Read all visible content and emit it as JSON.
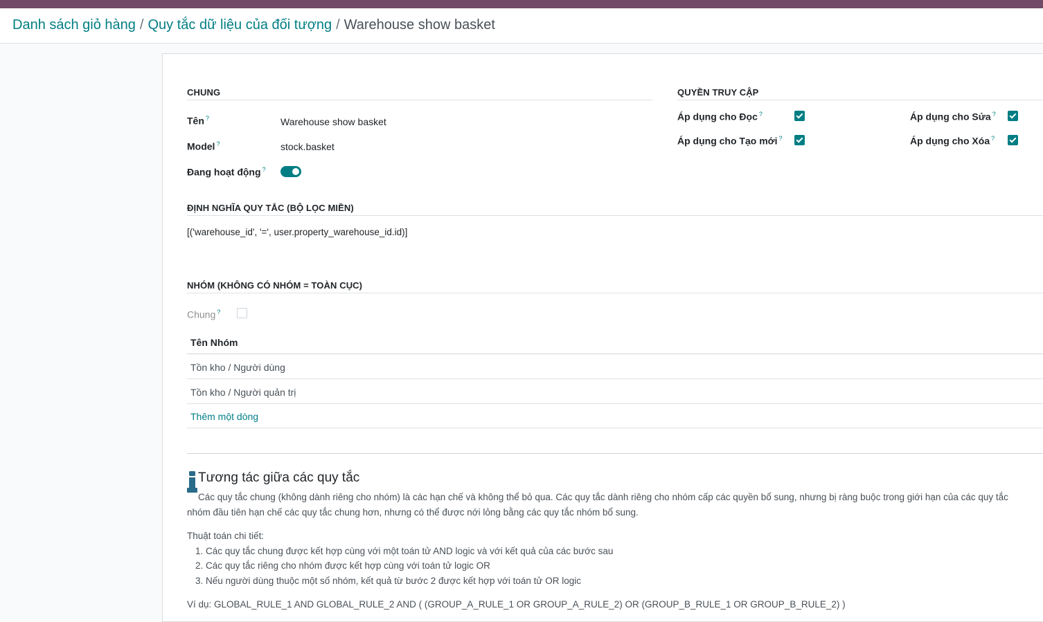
{
  "breadcrumb": {
    "items": [
      "Danh sách giỏ hàng",
      "Quy tắc dữ liệu của đối tượng"
    ],
    "current": "Warehouse show basket",
    "separator": "/"
  },
  "general": {
    "section_title": "CHUNG",
    "name_label": "Tên",
    "name_value": "Warehouse show basket",
    "model_label": "Model",
    "model_value": "stock.basket",
    "active_label": "Đang hoạt động",
    "active": true
  },
  "access": {
    "section_title": "QUYỀN TRUY CẬP",
    "read_label": "Áp dụng cho Đọc",
    "write_label": "Áp dụng cho Sửa",
    "create_label": "Áp dụng cho Tạo mới",
    "delete_label": "Áp dụng cho Xóa",
    "read": true,
    "write": true,
    "create": true,
    "delete": true
  },
  "domain": {
    "section_title": "ĐỊNH NGHĨA QUY TẮC (BỘ LỌC MIỀN)",
    "value": "[('warehouse_id', '=', user.property_warehouse_id.id)]"
  },
  "groups": {
    "section_title": "NHÓM (KHÔNG CÓ NHÓM = TOÀN CỤC)",
    "global_label": "Chung",
    "global_checked": false,
    "column_header": "Tên Nhóm",
    "rows": [
      "Tồn kho / Người dùng",
      "Tồn kho / Người quản trị"
    ],
    "add_line": "Thêm một dòng"
  },
  "help": {
    "title": "Tương tác giữa các quy tắc",
    "paragraph_line1": "Các quy tắc chung (không dành riêng cho nhóm) là các hạn chế và không thể bỏ qua. Các quy tắc dành riêng cho nhóm cấp các quyền bổ sung, nhưng bị ràng buộc trong giới hạn của các quy tắc",
    "paragraph_line2": "nhóm đầu tiên hạn chế các quy tắc chung hơn, nhưng có thể được nới lỏng bằng các quy tắc nhóm bổ sung.",
    "algorithm_title": "Thuật toán chi tiết:",
    "steps": [
      "1. Các quy tắc chung được kết hợp cùng với một toán tử AND logic và với kết quả của các bước sau",
      "2. Các quy tắc riêng cho nhóm được kết hợp cùng với toán tử logic OR",
      "3. Nếu người dùng thuộc một số nhóm, kết quả từ bước 2 được kết hợp với toán tử OR logic"
    ],
    "example": "Ví dụ: GLOBAL_RULE_1 AND GLOBAL_RULE_2 AND ( (GROUP_A_RULE_1 OR GROUP_A_RULE_2) OR (GROUP_B_RULE_1 OR GROUP_B_RULE_2) )"
  },
  "colors": {
    "brand": "#714b67",
    "accent": "#017e84"
  }
}
